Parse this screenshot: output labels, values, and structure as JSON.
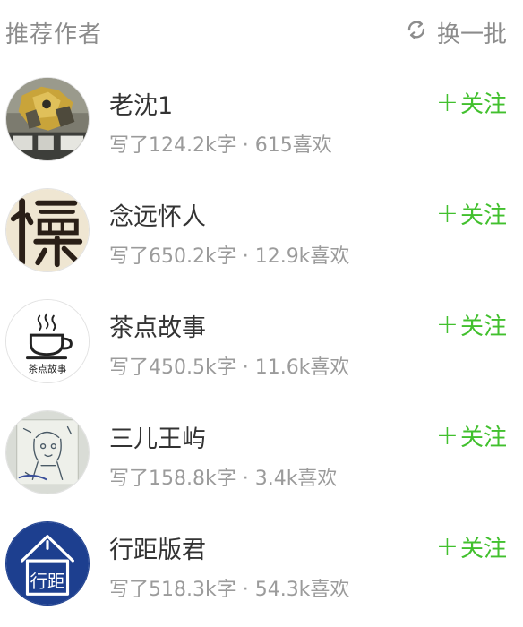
{
  "header": {
    "title": "推荐作者",
    "refresh_label": "换一批",
    "refresh_icon": "refresh-icon"
  },
  "colors": {
    "accent": "#42c02e",
    "muted": "#9b9b9b",
    "title": "#333333"
  },
  "authors": [
    {
      "name": "老沈1",
      "meta": "写了124.2k字 · 615喜欢",
      "follow_label": "关注",
      "avatar": "transformer-photo"
    },
    {
      "name": "念远怀人",
      "meta": "写了650.2k字 · 12.9k喜欢",
      "follow_label": "关注",
      "avatar": "calligraphy-huai"
    },
    {
      "name": "茶点故事",
      "meta": "写了450.5k字 · 11.6k喜欢",
      "follow_label": "关注",
      "avatar": "teacup-logo",
      "avatar_caption": "茶点故事"
    },
    {
      "name": "三儿王屿",
      "meta": "写了158.8k字 · 3.4k喜欢",
      "follow_label": "关注",
      "avatar": "sketch-drawing"
    },
    {
      "name": "行距版君",
      "meta": "写了518.3k字 · 54.3k喜欢",
      "follow_label": "关注",
      "avatar": "house-logo",
      "avatar_caption": "行距"
    }
  ]
}
